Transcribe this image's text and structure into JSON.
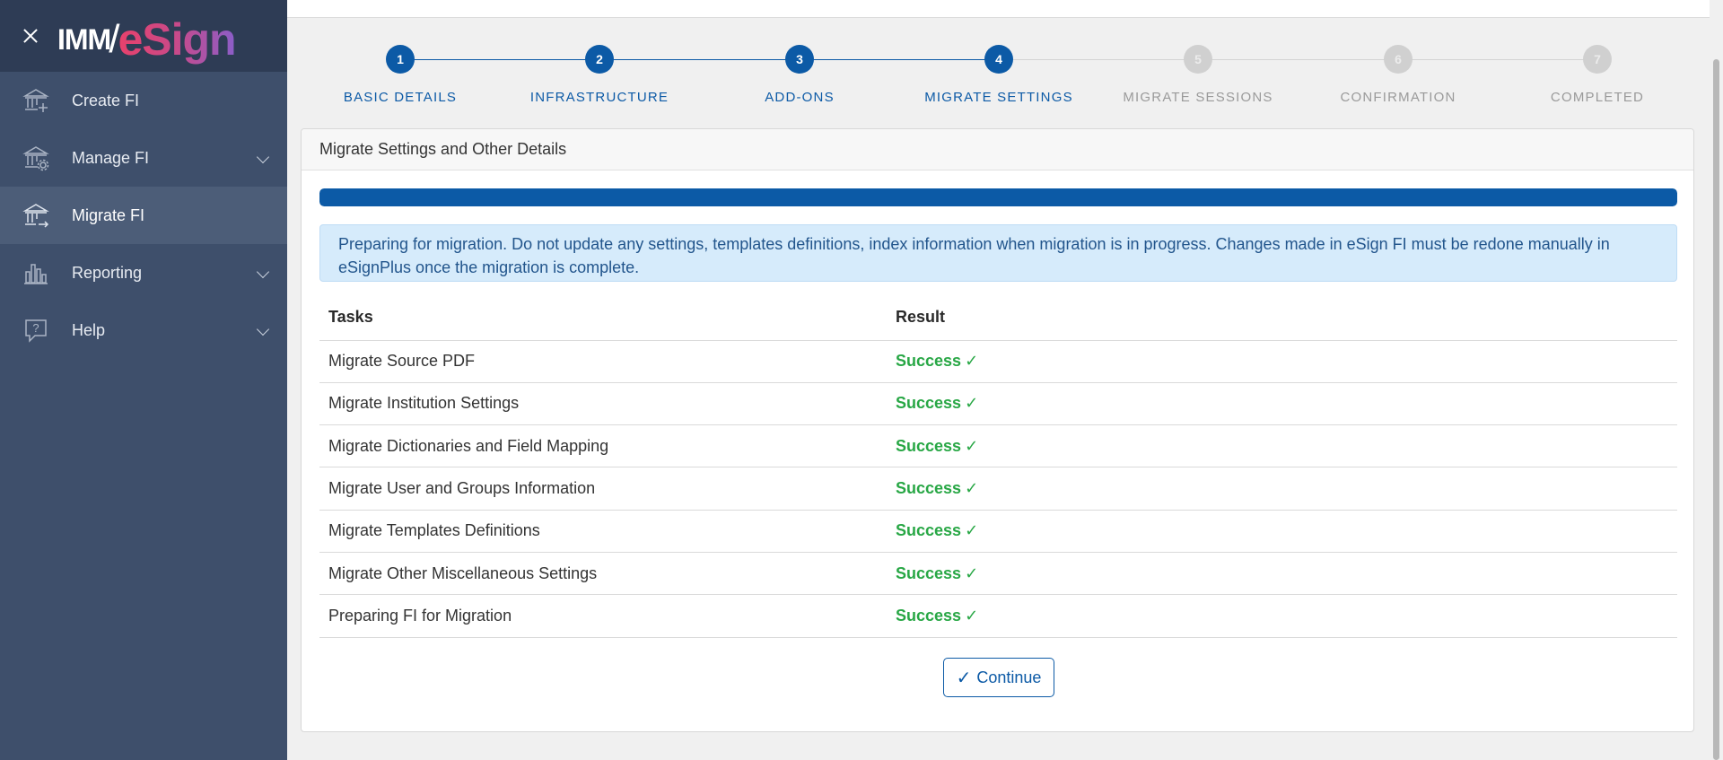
{
  "sidebar": {
    "logo_primary": "IMM",
    "logo_secondary": "eSign",
    "items": [
      {
        "label": "Create FI",
        "icon": "bank-plus-icon",
        "has_chevron": false,
        "active": false
      },
      {
        "label": "Manage FI",
        "icon": "bank-gear-icon",
        "has_chevron": true,
        "active": false
      },
      {
        "label": "Migrate FI",
        "icon": "bank-arrow-icon",
        "has_chevron": false,
        "active": true
      },
      {
        "label": "Reporting",
        "icon": "bar-chart-icon",
        "has_chevron": true,
        "active": false
      },
      {
        "label": "Help",
        "icon": "help-bubble-icon",
        "has_chevron": true,
        "active": false
      }
    ]
  },
  "stepper": {
    "current_step": 4,
    "steps": [
      {
        "number": "1",
        "label": "BASIC DETAILS"
      },
      {
        "number": "2",
        "label": "INFRASTRUCTURE"
      },
      {
        "number": "3",
        "label": "ADD-ONS"
      },
      {
        "number": "4",
        "label": "MIGRATE SETTINGS"
      },
      {
        "number": "5",
        "label": "MIGRATE SESSIONS"
      },
      {
        "number": "6",
        "label": "CONFIRMATION"
      },
      {
        "number": "7",
        "label": "COMPLETED"
      }
    ]
  },
  "card": {
    "title": "Migrate Settings and Other Details",
    "progress_percent": 100,
    "alert": "Preparing for migration. Do not update any settings, templates definitions, index information when migration is in progress. Changes made in eSign FI must be redone manually in eSignPlus once the migration is complete.",
    "table": {
      "headers": [
        "Tasks",
        "Result"
      ],
      "rows": [
        {
          "task": "Migrate Source PDF",
          "result": "Success"
        },
        {
          "task": "Migrate Institution Settings",
          "result": "Success"
        },
        {
          "task": "Migrate Dictionaries and Field Mapping",
          "result": "Success"
        },
        {
          "task": "Migrate User and Groups Information",
          "result": "Success"
        },
        {
          "task": "Migrate Templates Definitions",
          "result": "Success"
        },
        {
          "task": "Migrate Other Miscellaneous Settings",
          "result": "Success"
        },
        {
          "task": "Preparing FI for Migration",
          "result": "Success"
        }
      ]
    },
    "check_glyph": "✓",
    "continue_label": "Continue"
  },
  "colors": {
    "primary": "#0c5aa6",
    "success": "#28a745",
    "sidebar_bg": "#3e4f6b",
    "inactive_step": "#d0d0d0"
  }
}
